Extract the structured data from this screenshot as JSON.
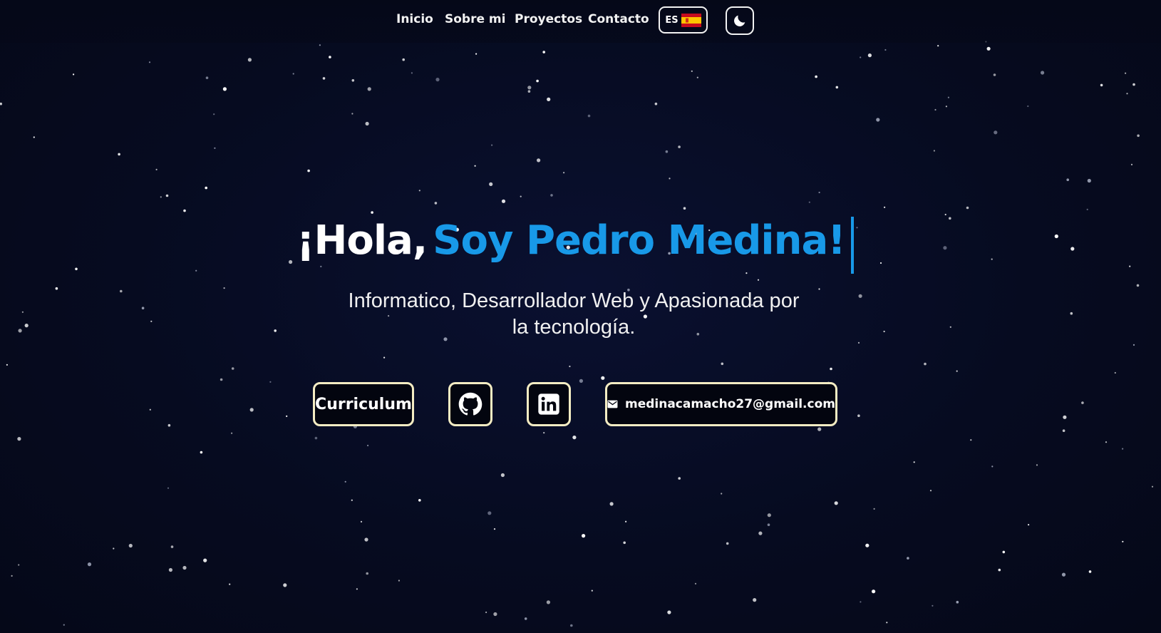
{
  "nav": {
    "links": [
      "Inicio",
      "Sobre mi",
      "Proyectos",
      "Contacto"
    ],
    "language_code": "ES",
    "language_flag_icon": "spain-flag-icon",
    "theme_icon": "moon-icon"
  },
  "hero": {
    "greeting": "¡Hola,",
    "name": "Soy Pedro Medina!",
    "subtitle_line1": "Informatico, Desarrollador Web y Apasionada por",
    "subtitle_line2": "la tecnología."
  },
  "actions": {
    "cv_label": "Curriculum",
    "github_icon": "github-icon",
    "linkedin_icon": "linkedin-icon",
    "email_icon": "mail-icon",
    "email": "medinacamacho27@gmail.com"
  },
  "colors": {
    "background": "#060b20",
    "accent": "#1899e8",
    "button_border": "#f4ecc3"
  }
}
